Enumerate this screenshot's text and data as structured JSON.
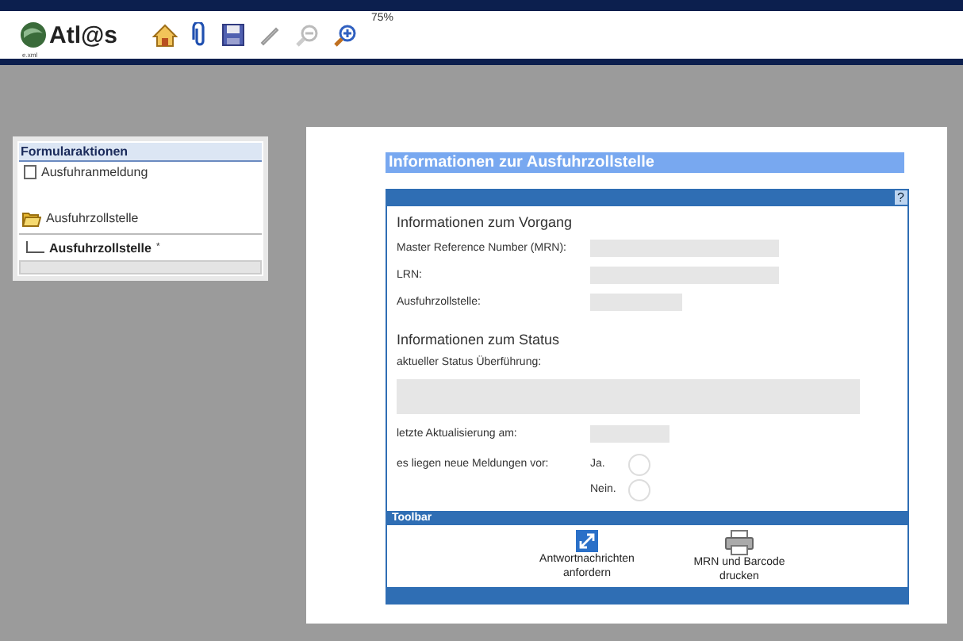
{
  "toolbar": {
    "logo": "Atl@s",
    "logo_sub": "e.xml",
    "zoom": "75%"
  },
  "sidebar": {
    "title": "Formularaktionen",
    "items": [
      {
        "kind": "document",
        "label": "Ausfuhranmeldung"
      },
      {
        "kind": "folder",
        "label": "Ausfuhrzollstelle"
      },
      {
        "kind": "child",
        "label": "Ausfuhrzollstelle",
        "suffix": "*"
      }
    ]
  },
  "form": {
    "title": "Informationen zur Ausfuhrzollstelle",
    "help": "?",
    "section_1": "Informationen zum Vorgang",
    "fields_1": [
      {
        "label": "Master Reference Number (MRN):",
        "kind": "long"
      },
      {
        "label": "LRN:",
        "kind": "long"
      },
      {
        "label": "Ausfuhrzollstelle:",
        "kind": "short"
      }
    ],
    "section_2": "Informationen zum Status",
    "status_label": "aktueller Status Überführung:",
    "update_label": "letzte Aktualisierung am:",
    "messages_label": "es liegen neue Meldungen vor:",
    "options": [
      {
        "label": "Ja.",
        "selected": false
      },
      {
        "label": "Nein.",
        "selected": false
      }
    ],
    "toolbar_title": "Toolbar",
    "actions": [
      {
        "kind": "request",
        "label": "Antwortnachrichten anfordern"
      },
      {
        "kind": "print",
        "label": "MRN und Barcode drucken"
      }
    ]
  }
}
